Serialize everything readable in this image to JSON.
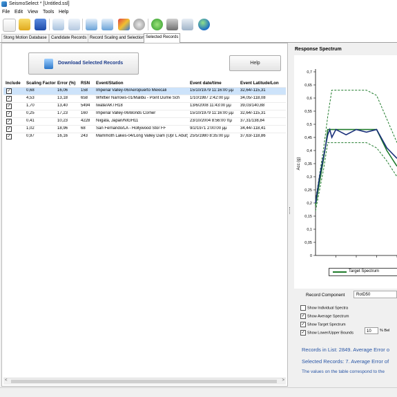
{
  "window": {
    "title": "SeismoSelect * [Untitled.ssl]"
  },
  "menu": [
    "File",
    "Edit",
    "View",
    "Tools",
    "Help"
  ],
  "tabs": [
    "Stong Motion Database",
    "Candidate Records",
    "Record Scaling and Selection",
    "Selected Records"
  ],
  "buttons": {
    "download": "Download Selected Records",
    "help": "Help"
  },
  "table": {
    "columns": [
      "Include",
      "Scaling Factor",
      "Error (%)",
      "RSN",
      "Event/Station",
      "Event date/time",
      "Event Latitude/Lon"
    ],
    "rows": [
      [
        "0,68",
        "16,06",
        "158",
        "Imperial Valley-06/Aeropuerto Mexicali",
        "15/10/1979 11:16:00 μμ",
        "32,64/-115,31"
      ],
      [
        "4,53",
        "13,18",
        "658",
        "Whittier Narrows-01/Malibu - Point Dume Sch",
        "1/10/1987 2:42:00 μμ",
        "34,05/-118,08"
      ],
      [
        "1,70",
        "13,40",
        "5494",
        "Iwate/AKTH18",
        "13/6/2008 11:43:00 μμ",
        "39,03/140,88"
      ],
      [
        "0,25",
        "17,23",
        "160",
        "Imperial Valley-06/Bonds Corner",
        "15/10/1979 11:16:00 μμ",
        "32,64/-115,31"
      ],
      [
        "0,41",
        "10,23",
        "4228",
        "Niigata, Japan/NIGH11",
        "23/10/2004 8:56:00 πμ",
        "37,31/138,84"
      ],
      [
        "1,02",
        "18,96",
        "68",
        "San Fernando/LA - Hollywood Stor FF",
        "9/2/1971 2:00:00 μμ",
        "34,44/-118,41"
      ],
      [
        "0,97",
        "16,16",
        "243",
        "Mammoth Lakes-04/Long Valley Dam (Upr L Abut)",
        "25/5/1980 8:35:00 μμ",
        "37,63/-118,86"
      ]
    ]
  },
  "right": {
    "chart_title": "Response Spectrum",
    "record_component_label": "Record Component",
    "record_component_value": "RotD50",
    "checkboxes": [
      {
        "label": "Show Individual Spectra",
        "checked": false
      },
      {
        "label": "Show Average Spectrum",
        "checked": true
      },
      {
        "label": "Show Target Spectrum",
        "checked": true
      },
      {
        "label": "Show Lower/Upper Bounds",
        "checked": true
      }
    ],
    "bound_value": "10",
    "bound_suffix": "% Bel",
    "info1": "Records in List: 2849. Average Error o",
    "info2": "Selected Records: 7. Average Error of",
    "info3": "The values on the table correspond to the"
  },
  "chart_data": {
    "type": "line",
    "ylabel": "Acc (g)",
    "ylim": [
      0,
      0.7
    ],
    "yticks": [
      "0",
      "0,05",
      "0,1",
      "0,15",
      "0,2",
      "0,25",
      "0,3",
      "0,35",
      "0,4",
      "0,45",
      "0,5",
      "0,55",
      "0,6",
      "0,65",
      "0,7"
    ],
    "x": [
      0,
      0.04,
      0.08,
      0.1,
      0.12,
      0.14,
      0.16,
      0.2,
      0.3,
      0.4,
      0.5,
      0.6,
      0.7,
      0.8
    ],
    "series": [
      {
        "name": "Target Spectrum",
        "color": "#1e7a2a",
        "style": "solid",
        "values": [
          0.19,
          0.28,
          0.37,
          0.42,
          0.48,
          0.48,
          0.48,
          0.48,
          0.48,
          0.48,
          0.48,
          0.48,
          0.4,
          0.34
        ]
      },
      {
        "name": "",
        "color": "#1e7a2a",
        "style": "dashed",
        "values": [
          0.21,
          0.31,
          0.41,
          0.47,
          0.53,
          0.58,
          0.63,
          0.63,
          0.63,
          0.63,
          0.63,
          0.61,
          0.52,
          0.43
        ]
      },
      {
        "name": "",
        "color": "#1e7a2a",
        "style": "dashed",
        "values": [
          0.17,
          0.25,
          0.33,
          0.38,
          0.43,
          0.43,
          0.43,
          0.43,
          0.43,
          0.43,
          0.43,
          0.41,
          0.36,
          0.3
        ]
      },
      {
        "name": "",
        "color": "#1a2f7a",
        "style": "solid",
        "values": [
          0.2,
          0.3,
          0.38,
          0.42,
          0.46,
          0.48,
          0.45,
          0.48,
          0.46,
          0.48,
          0.47,
          0.48,
          0.41,
          0.37
        ]
      }
    ],
    "legend": "bottom"
  }
}
